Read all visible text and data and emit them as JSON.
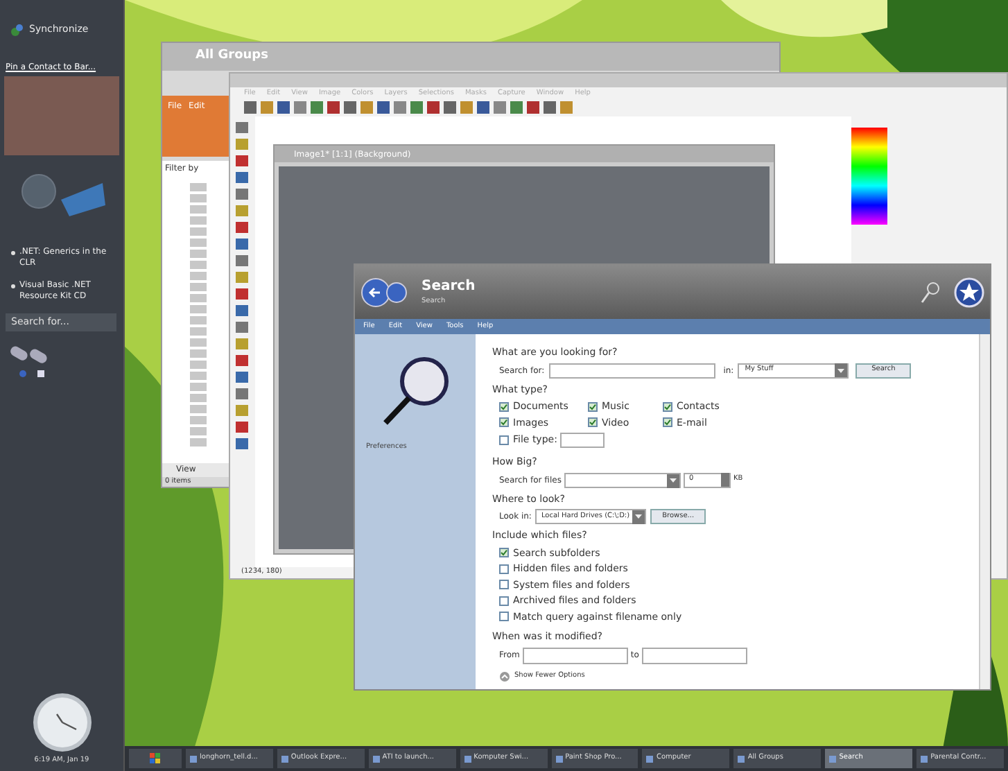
{
  "sidebar": {
    "header": "Synchronize",
    "contact_label": "Pin a Contact to Bar...",
    "links": [
      ".NET: Generics in the CLR",
      "Visual Basic .NET Resource Kit CD"
    ],
    "search": {
      "placeholder": "Search for..."
    },
    "clock_time": "6:19 AM, Jan 19"
  },
  "all_groups_window": {
    "title": "All Groups",
    "menu": [
      "File",
      "Edit"
    ],
    "filter": {
      "placeholder": "Filter by"
    },
    "view_button": "View",
    "status": "0 items"
  },
  "paint_window": {
    "menu": [
      "File",
      "Edit",
      "View",
      "Image",
      "Colors",
      "Layers",
      "Selections",
      "Masks",
      "Capture",
      "Window",
      "Help"
    ],
    "image_title": "Image1* [1:1] (Background)",
    "coords": "(1234, 180)"
  },
  "search_window": {
    "title": "Search",
    "subtitle": "Search",
    "menu": [
      "File",
      "Edit",
      "View",
      "Tools",
      "Help"
    ],
    "side_label": "Preferences",
    "q1": "What are you looking for?",
    "search_label": "Search for:",
    "in_label": "in:",
    "location": "My Stuff",
    "search_button": "Search",
    "q2": "What type?",
    "types": [
      {
        "label": "Documents",
        "checked": true
      },
      {
        "label": "Music",
        "checked": true
      },
      {
        "label": "Contacts",
        "checked": true
      },
      {
        "label": "Images",
        "checked": true
      },
      {
        "label": "Video",
        "checked": true
      },
      {
        "label": "E-mail",
        "checked": true
      }
    ],
    "file_type": {
      "label": "File type:",
      "checked": false
    },
    "q3": "How Big?",
    "size_label": "Search for files",
    "size_value": "0",
    "size_unit": "KB",
    "q4": "Where to look?",
    "look_label": "Look in:",
    "look_value": "Local Hard Drives (C:\\;D:)",
    "browse_button": "Browse...",
    "q5": "Include which files?",
    "includes": [
      {
        "label": "Search subfolders",
        "checked": true
      },
      {
        "label": "Hidden files and folders",
        "checked": false
      },
      {
        "label": "System files and folders",
        "checked": false
      },
      {
        "label": "Archived files and folders",
        "checked": false
      },
      {
        "label": "Match query against filename only",
        "checked": false
      }
    ],
    "q6": "When was it modified?",
    "from_label": "From",
    "to_label": "to",
    "fewer_options": "Show Fewer Options"
  },
  "taskbar": {
    "items": [
      {
        "label": "longhorn_tell.d...",
        "selected": false
      },
      {
        "label": "Outlook Expre...",
        "selected": false
      },
      {
        "label": "ATI to launch...",
        "selected": false
      },
      {
        "label": "Komputer Swi...",
        "selected": false
      },
      {
        "label": "Paint Shop Pro...",
        "selected": false
      },
      {
        "label": "Computer",
        "selected": false
      },
      {
        "label": "All Groups",
        "selected": false
      },
      {
        "label": "Search",
        "selected": true
      },
      {
        "label": "Parental Contr...",
        "selected": false
      }
    ]
  }
}
